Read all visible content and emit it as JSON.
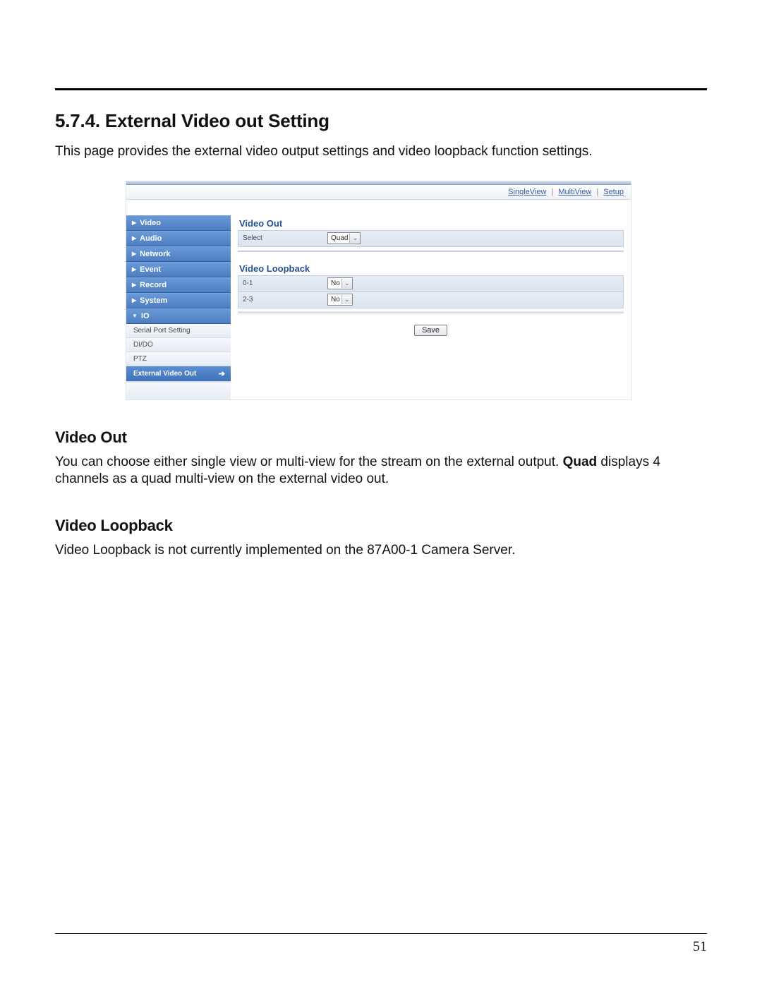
{
  "section_heading": "5.7.4. External Video out Setting",
  "intro_text": "This page provides the external video output settings and video loopback function settings.",
  "page_number": "51",
  "embedded_ui": {
    "topbar": {
      "single_view": "SingleView",
      "multi_view": "MultiView",
      "setup": "Setup"
    },
    "sidebar": {
      "main": {
        "video": "Video",
        "audio": "Audio",
        "network": "Network",
        "event": "Event",
        "record": "Record",
        "system": "System",
        "io": "IO"
      },
      "sub": {
        "serial": "Serial Port Setting",
        "dido": "DI/DO",
        "ptz": "PTZ",
        "ext_video_out": "External Video Out"
      }
    },
    "content": {
      "video_out_title": "Video Out",
      "video_out_select_label": "Select",
      "video_out_select_value": "Quad",
      "video_loopback_title": "Video Loopback",
      "loopback_row1_label": "0-1",
      "loopback_row1_value": "No",
      "loopback_row2_label": "2-3",
      "loopback_row2_value": "No",
      "save_label": "Save"
    }
  },
  "sub_video_out_heading": "Video Out",
  "video_out_text_a": "You can choose either single view or multi-view for the stream on the external output.  ",
  "video_out_text_bold": "Quad",
  "video_out_text_b": " displays 4 channels as a quad multi-view on the external video out.",
  "sub_video_loopback_heading": "Video Loopback",
  "video_loopback_text": "Video Loopback is not currently implemented on the 87A00-1 Camera Server."
}
